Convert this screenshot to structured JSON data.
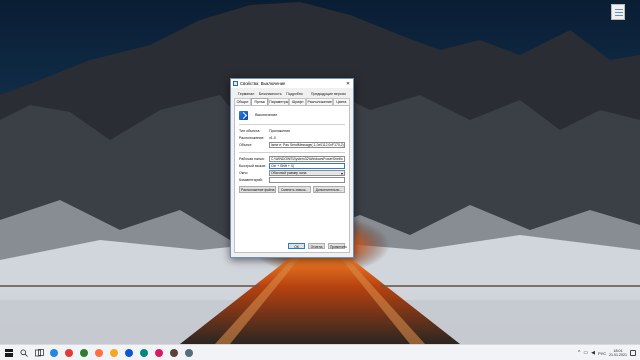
{
  "dialog": {
    "title": "Свойства: Выключение",
    "close_glyph": "✕",
    "tabs_row1": [
      "Терминал",
      "Безопасность",
      "Подробно",
      "Предыдущие версии"
    ],
    "tabs_row2": [
      "Общие",
      "Ярлык",
      "Параметры",
      "Шрифт",
      "Расположение",
      "Цвета"
    ],
    "active_tab": "Ярлык",
    "shortcut_name": "Выключение",
    "fields": {
      "type_label": "Тип объекта:",
      "type_value": "Приложение",
      "location_label": "Расположение:",
      "location_value": "v1.0",
      "target_label": "Объект:",
      "target_value": "lame e; Pas SendMessage(-1,0x0112,0xF170,2)",
      "workdir_label": "Рабочая папка:",
      "workdir_value": "C:\\WINDOWS\\System32\\WindowsPowerShell\\v",
      "hotkey_label": "Быстрый вызов:",
      "hotkey_value": "Ctrl + Shift + X|",
      "window_label": "Окно:",
      "window_value": "Обычный размер окна",
      "comment_label": "Комментарий:",
      "comment_value": ""
    },
    "buttons": {
      "open_location": "Расположение файла",
      "change_icon": "Сменить значок...",
      "advanced": "Дополнительно...",
      "ok": "ОК",
      "cancel": "Отмена",
      "apply": "Применить"
    }
  },
  "taskbar": {
    "language": "РУС",
    "time": "18:01",
    "date": "21.01.2021",
    "app_colors": [
      "#1e88e5",
      "#e53935",
      "#2e7d32",
      "#ff7043",
      "#f5a623",
      "#0b57d0",
      "#00897b",
      "#d81b60",
      "#5d4037",
      "#546e7a"
    ]
  }
}
